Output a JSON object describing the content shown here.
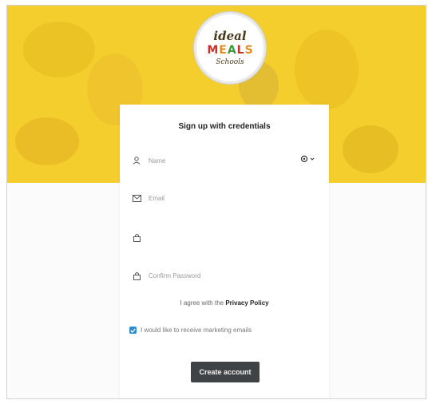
{
  "brand": {
    "logo_top": "ideal",
    "logo_middle_letters": [
      "M",
      "E",
      "A",
      "L",
      "S"
    ],
    "logo_middle_colors": [
      "#c8322a",
      "#e58a1f",
      "#3c9a3c",
      "#c8322a",
      "#e58a1f"
    ],
    "logo_bottom": "Schools"
  },
  "form": {
    "title": "Sign up with credentials",
    "fields": [
      {
        "icon": "user-icon",
        "placeholder": "Name"
      },
      {
        "icon": "mail-icon",
        "placeholder": "Email"
      },
      {
        "icon": "lock-icon",
        "placeholder": ""
      },
      {
        "icon": "lock-icon",
        "placeholder": "Confirm Password"
      }
    ],
    "agree_prefix": "I agree with the",
    "agree_link": "Privacy Policy",
    "newsletter_label": "I would like to receive marketing emails",
    "newsletter_checked": true,
    "submit_label": "Create account"
  },
  "colors": {
    "hero_yellow": "#f4ce2c",
    "button_bg": "#404345",
    "checkbox_blue": "#2d8bd6"
  }
}
